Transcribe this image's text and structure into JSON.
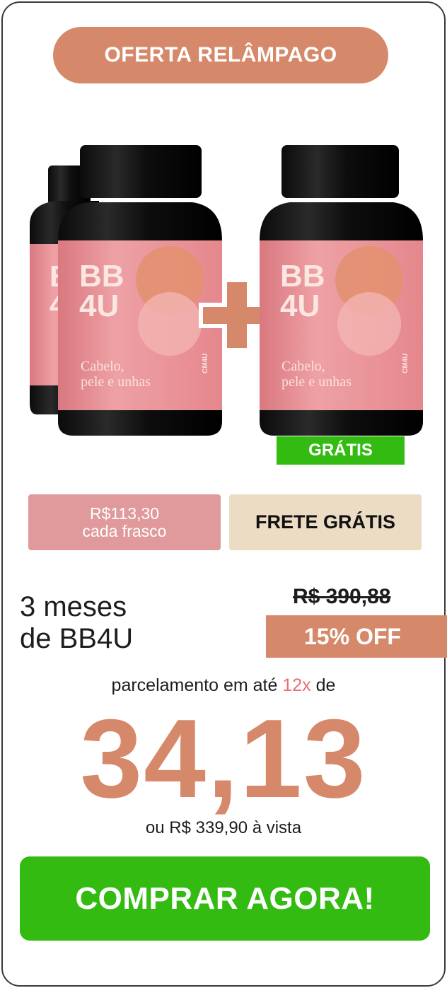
{
  "banner": {
    "label": "OFERTA RELÂMPAGO"
  },
  "product": {
    "brand_line1": "BB",
    "brand_line2": "4U",
    "tagline_line1": "Cabelo,",
    "tagline_line2": "pele e unhas",
    "side_logo": "CM4U",
    "free_badge": "GRÁTIS"
  },
  "pricing": {
    "per_unit_line1": "R$113,30",
    "per_unit_line2": "cada frasco",
    "shipping": "FRETE GRÁTIS",
    "plan_line1": "3 meses",
    "plan_line2": "de BB4U",
    "old_price": "R$ 390,88",
    "discount": "15% OFF",
    "installment_prefix": "parcelamento em até",
    "installment_count": "12x",
    "installment_suffix": "de",
    "installment_value": "34,13",
    "cash_price": "ou R$ 339,90 à vista"
  },
  "cta": {
    "label": "COMPRAR AGORA!"
  },
  "colors": {
    "accent": "#d6896a",
    "label_pink": "#e7959b",
    "green": "#33bb12",
    "beige": "#ecdcc4",
    "highlight": "#e96e73"
  },
  "icons": [
    "plus-icon"
  ]
}
